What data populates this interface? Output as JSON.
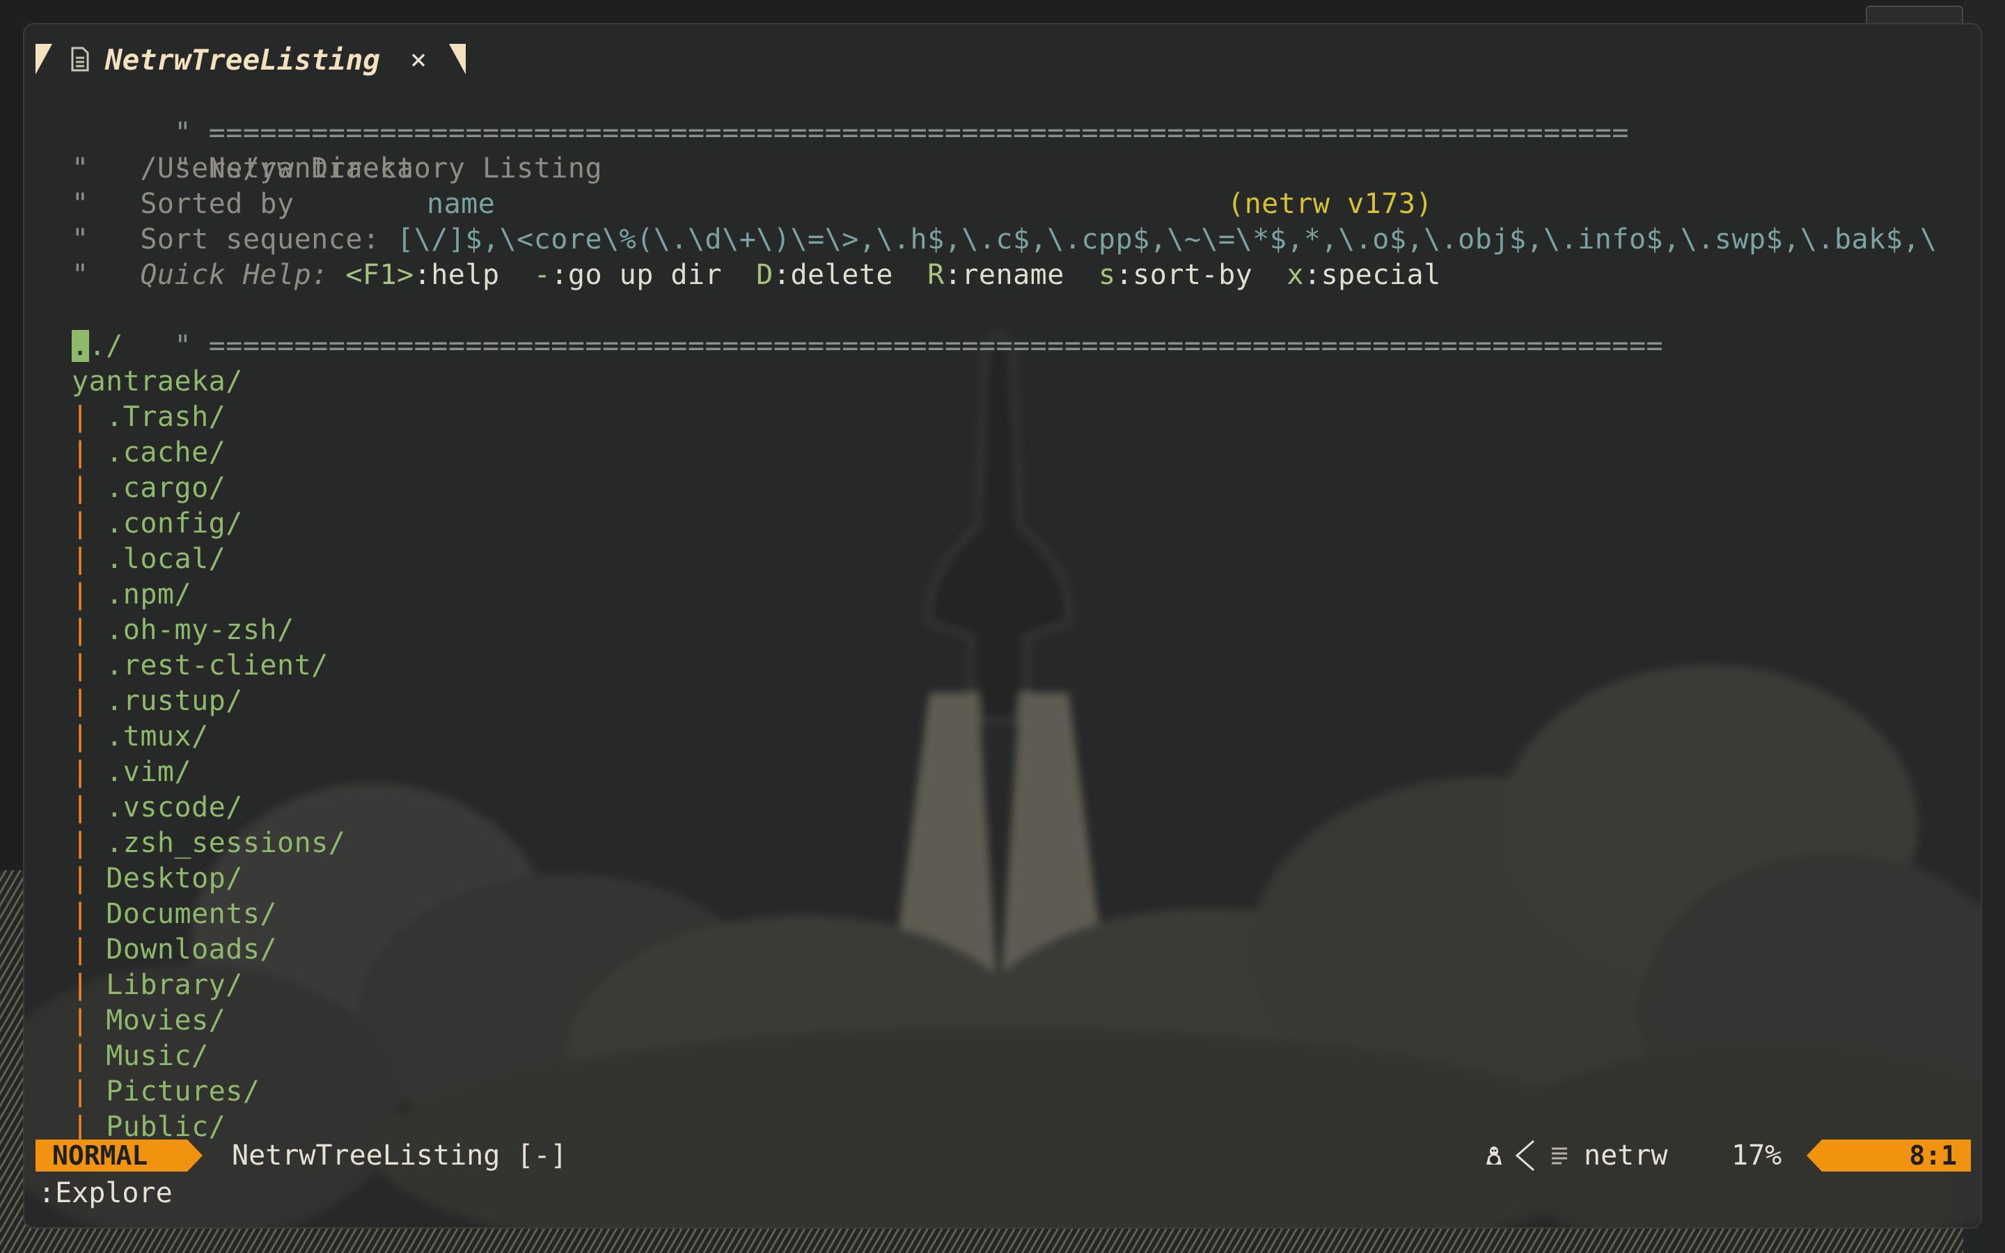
{
  "tab": {
    "title": "NetrwTreeListing",
    "close_glyph": "×",
    "file_icon": "file-icon"
  },
  "header": {
    "rule1": "\" ===================================================================================",
    "title_prefix": "\" Netrw Directory Listing",
    "version": "(netrw v173)",
    "path_prefix": "\"   ",
    "path": "/Users/yantraeka",
    "sorted_prefix": "\"   Sorted by",
    "sorted_value": "name",
    "seq_prefix": "\"   Sort sequence: ",
    "seq_value": "[\\/]$,\\<core\\%(\\.\\d\\+\\)\\=\\>,\\.h$,\\.c$,\\.cpp$,\\~\\=\\*$,*,\\.o$,\\.obj$,\\.info$,\\.swp$,\\.bak$,\\",
    "help_prefix": "\"   ",
    "help_label": "Quick Help: ",
    "help_items": [
      {
        "key": "<F1>",
        "text": ":help  "
      },
      {
        "key": "-",
        "text": ":go up dir  "
      },
      {
        "key": "D",
        "text": ":delete  "
      },
      {
        "key": "R",
        "text": ":rename  "
      },
      {
        "key": "s",
        "text": ":sort-by  "
      },
      {
        "key": "x",
        "text": ":special"
      }
    ],
    "rule2": "\" ====================================================================================="
  },
  "tree": {
    "current_cursor": ".",
    "current_rest": "./",
    "root": "yantraeka/",
    "branch_glyph": "|",
    "entries": [
      ".Trash/",
      ".cache/",
      ".cargo/",
      ".config/",
      ".local/",
      ".npm/",
      ".oh-my-zsh/",
      ".rest-client/",
      ".rustup/",
      ".tmux/",
      ".vim/",
      ".vscode/",
      ".zsh_sessions/",
      "Desktop/",
      "Documents/",
      "Downloads/",
      "Library/",
      "Movies/",
      "Music/",
      "Pictures/",
      "Public/"
    ]
  },
  "statusline": {
    "mode": "NORMAL",
    "file": "NetrwTreeListing [-]",
    "filetype": "netrw",
    "percent": "17%",
    "position": "8:1",
    "os_icon": "linux-icon",
    "accent": "#f29310"
  },
  "cmdline": ":Explore"
}
